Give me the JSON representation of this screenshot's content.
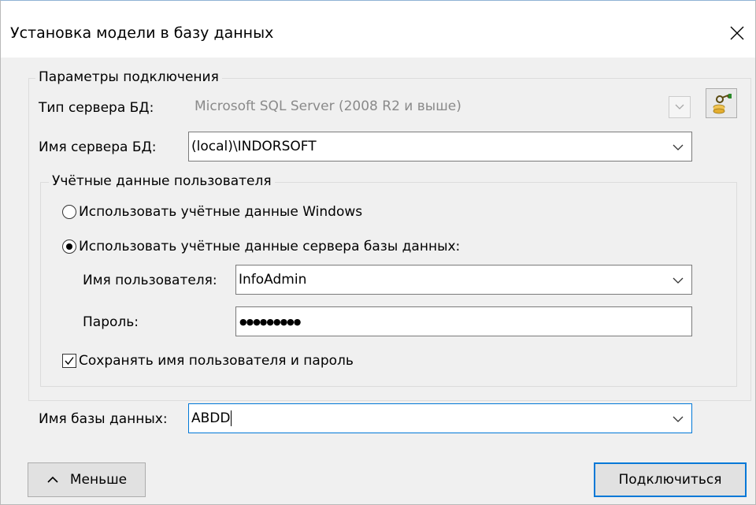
{
  "window": {
    "title": "Установка модели в базу данных"
  },
  "connection": {
    "legend": "Параметры подключения",
    "server_type_label": "Тип сервера БД:",
    "server_type_value": "Microsoft SQL Server (2008 R2 и выше)",
    "server_name_label": "Имя сервера БД:",
    "server_name_value": "(local)\\INDORSOFT"
  },
  "credentials": {
    "legend": "Учётные данные пользователя",
    "radio_windows": "Использовать учётные данные Windows",
    "radio_server": "Использовать учётные данные сервера базы данных:",
    "selected": "server",
    "username_label": "Имя пользователя:",
    "username_value": "InfoAdmin",
    "password_label": "Пароль:",
    "password_mask": "●●●●●●●●●",
    "save_label": "Сохранять имя пользователя и пароль",
    "save_checked": true
  },
  "database": {
    "label": "Имя базы данных:",
    "value": "ABDD"
  },
  "buttons": {
    "less": "Меньше",
    "connect": "Подключиться"
  },
  "colors": {
    "accent": "#0078d7"
  }
}
